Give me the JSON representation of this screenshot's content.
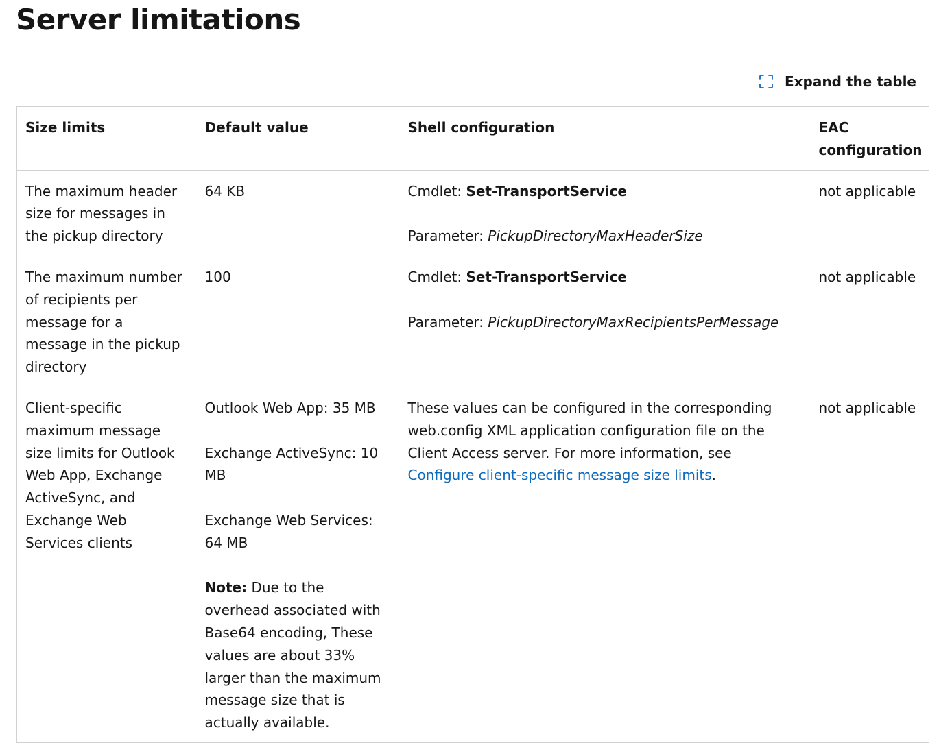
{
  "title": "Server limitations",
  "expand": {
    "icon": "expand-corners-icon",
    "label": "Expand the table",
    "accent": "#0f6cbd"
  },
  "table": {
    "headers": [
      "Size limits",
      "Default value",
      "Shell configuration",
      "EAC configuration"
    ],
    "row1": {
      "limit": "The maximum header size for messages in the pickup directory",
      "default": "64 KB",
      "cmdlet_label": "Cmdlet: ",
      "cmdlet": "Set-TransportService",
      "param_label": "Parameter: ",
      "param": "PickupDirectoryMaxHeaderSize",
      "eac": "not applicable"
    },
    "row2": {
      "limit": "The maximum number of recipients per message for a message in the pickup directory",
      "default": "100",
      "cmdlet_label": "Cmdlet: ",
      "cmdlet": "Set-TransportService",
      "param_label": "Parameter: ",
      "param": "PickupDirectoryMaxRecipientsPerMessage",
      "eac": "not applicable"
    },
    "row3": {
      "limit": "Client-specific maximum message size limits for Outlook Web App, Exchange ActiveSync, and Exchange Web Services clients",
      "default_owa": "Outlook Web App: 35 MB",
      "default_eas": "Exchange ActiveSync: 10 MB",
      "default_ews": "Exchange Web Services: 64 MB",
      "note_label": "Note:",
      "note_text": " Due to the overhead associated with Base64 encoding, These values are about 33% larger than the maximum message size that is actually available.",
      "shell_text": "These values can be configured in the corresponding web.config XML application configuration file on the Client Access server. For more information, see ",
      "shell_link": "Configure client-specific message size limits",
      "shell_end": ".",
      "eac": "not applicable"
    }
  }
}
